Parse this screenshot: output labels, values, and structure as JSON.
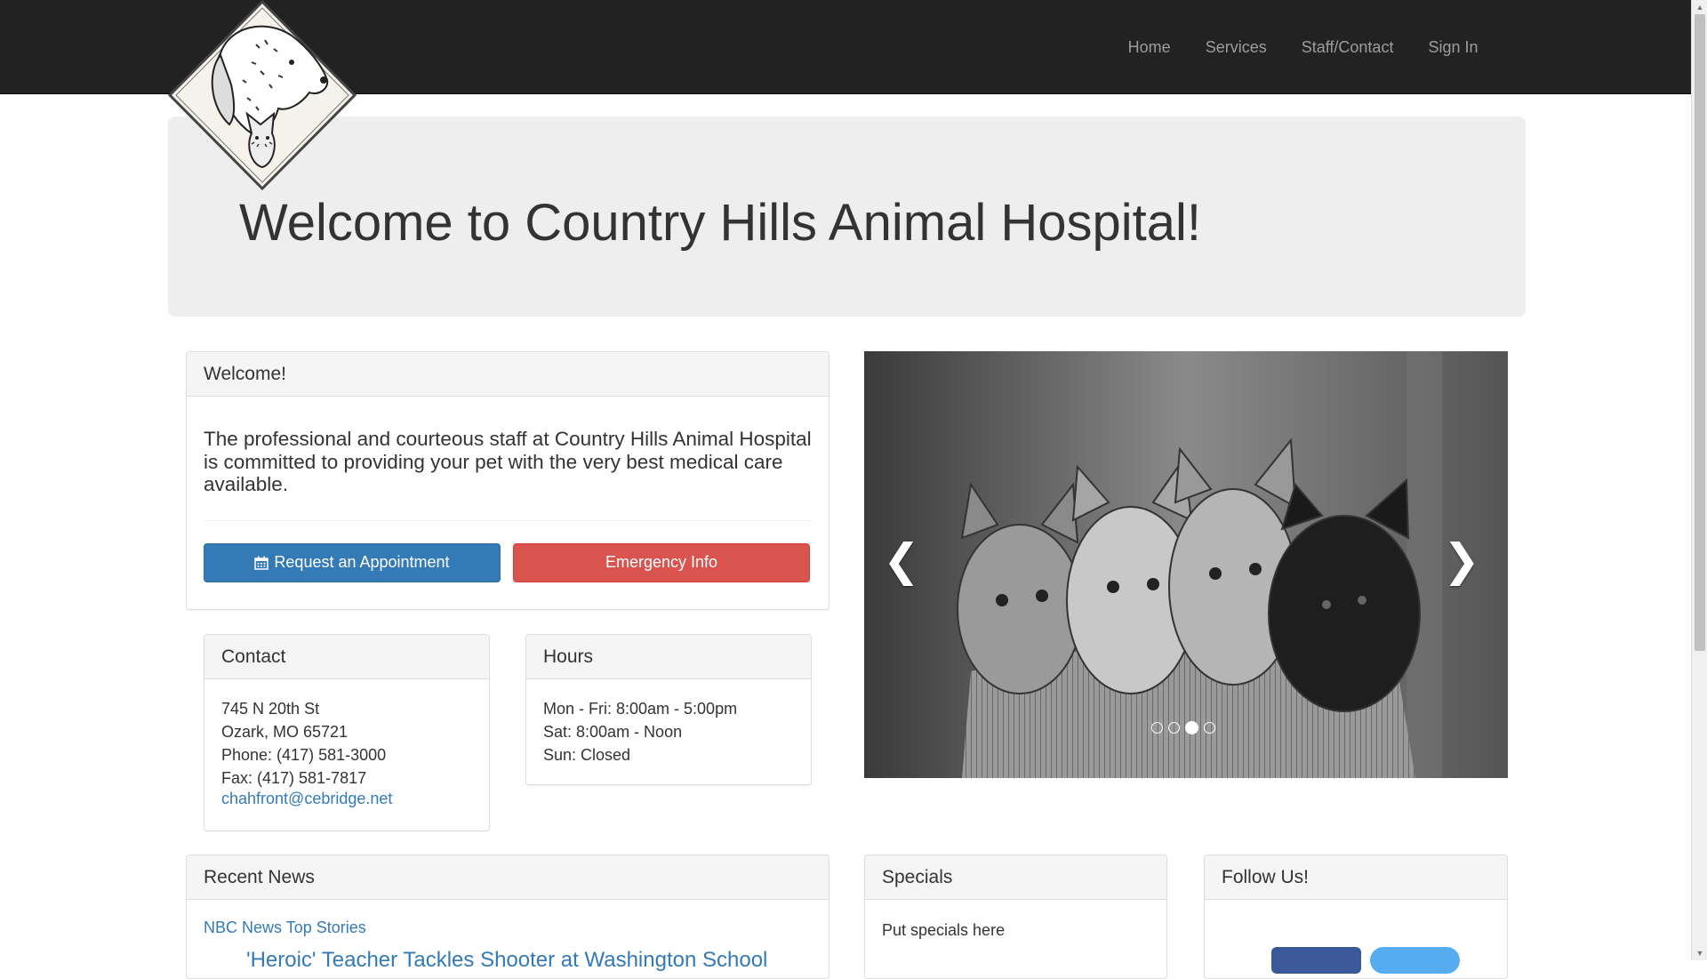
{
  "nav": {
    "items": [
      "Home",
      "Services",
      "Staff/Contact",
      "Sign In"
    ]
  },
  "jumbotron": {
    "title": "Welcome to Country Hills Animal Hospital!"
  },
  "welcome": {
    "heading": "Welcome!",
    "text": "The professional and courteous staff at Country Hills Animal Hospital is committed to providing your pet with the very best medical care available.",
    "appointment_button": "Request an Appointment",
    "emergency_button": "Emergency Info"
  },
  "contact": {
    "heading": "Contact",
    "address_line1": "745 N 20th St",
    "address_line2": "Ozark, MO 65721",
    "phone": "Phone: (417) 581-3000",
    "fax": "Fax: (417) 581-7817",
    "email": "chahfront@cebridge.net"
  },
  "hours": {
    "heading": "Hours",
    "weekday": "Mon - Fri: 8:00am - 5:00pm",
    "saturday": "Sat: 8:00am - Noon",
    "sunday": "Sun: Closed"
  },
  "carousel": {
    "prev_icon": "chevron-left",
    "next_icon": "chevron-right",
    "slide_count": 4,
    "active_slide": 3
  },
  "news": {
    "heading": "Recent News",
    "source_link": "NBC News Top Stories",
    "headline": "'Heroic' Teacher Tackles Shooter at Washington School"
  },
  "specials": {
    "heading": "Specials",
    "text": "Put specials here"
  },
  "follow": {
    "heading": "Follow Us!",
    "facebook_color": "#3b5998",
    "twitter_color": "#55acee"
  },
  "colors": {
    "navbar": "#222222",
    "primary": "#337ab7",
    "danger": "#d9534f"
  }
}
